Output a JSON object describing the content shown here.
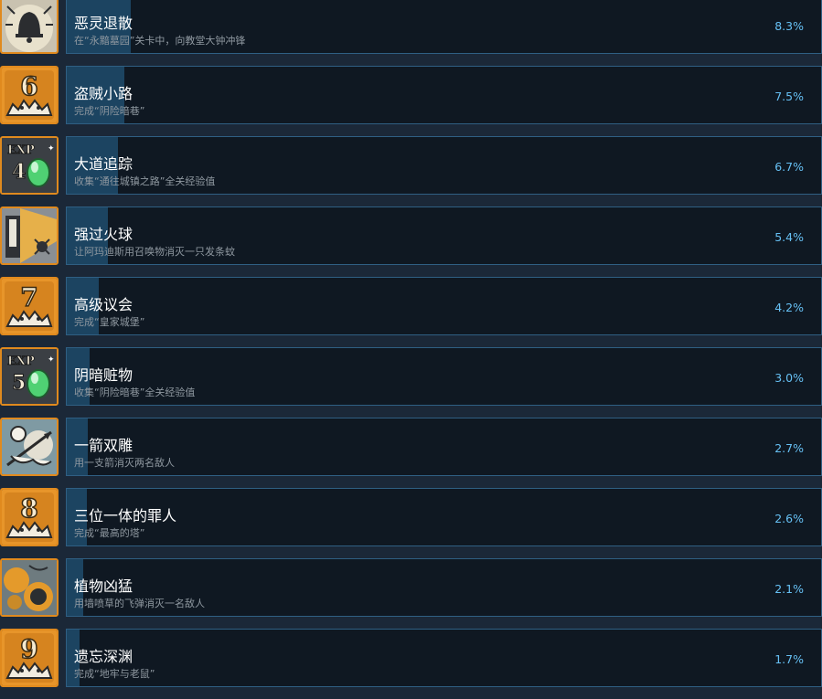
{
  "colors": {
    "background": "#1b2838",
    "bar_background": "#0f1822",
    "bar_border": "#2f5f83",
    "bar_fill": "#1c4461",
    "icon_frame": "#e08a1e",
    "percent_text": "#66c0f4"
  },
  "achievements": [
    {
      "title": "恶灵退散",
      "description": "在“永黯墓园”关卡中，向教堂大钟冲锋",
      "percent": "8.3%",
      "unlock_rate": 8.3,
      "icon": "bell-icon",
      "icon_number": ""
    },
    {
      "title": "盗贼小路",
      "description": "完成“阴险暗巷”",
      "percent": "7.5%",
      "unlock_rate": 7.5,
      "icon": "level-badge-icon",
      "icon_number": "6"
    },
    {
      "title": "大道追踪",
      "description": "收集“通往城镇之路”全关经验值",
      "percent": "6.7%",
      "unlock_rate": 6.7,
      "icon": "exp-gem-icon",
      "icon_number": "4"
    },
    {
      "title": "强过火球",
      "description": "让阿玛迪斯用召唤物消灭一只发条蚊",
      "percent": "5.4%",
      "unlock_rate": 5.4,
      "icon": "summon-icon",
      "icon_number": ""
    },
    {
      "title": "高级议会",
      "description": "完成“皇家城堡”",
      "percent": "4.2%",
      "unlock_rate": 4.2,
      "icon": "level-badge-icon",
      "icon_number": "7"
    },
    {
      "title": "阴暗赃物",
      "description": "收集“阴险暗巷”全关经验值",
      "percent": "3.0%",
      "unlock_rate": 3.0,
      "icon": "exp-gem-icon",
      "icon_number": "5"
    },
    {
      "title": "一箭双雕",
      "description": "用一支箭消灭两名敌人",
      "percent": "2.7%",
      "unlock_rate": 2.7,
      "icon": "arrow-strike-icon",
      "icon_number": ""
    },
    {
      "title": "三位一体的罪人",
      "description": "完成“最高的塔”",
      "percent": "2.6%",
      "unlock_rate": 2.6,
      "icon": "level-badge-icon",
      "icon_number": "8"
    },
    {
      "title": "植物凶猛",
      "description": "用墙喷草的飞弹消灭一名敌人",
      "percent": "2.1%",
      "unlock_rate": 2.1,
      "icon": "plant-icon",
      "icon_number": ""
    },
    {
      "title": "遗忘深渊",
      "description": "完成“地牢与老鼠”",
      "percent": "1.7%",
      "unlock_rate": 1.7,
      "icon": "level-badge-icon",
      "icon_number": "9"
    }
  ]
}
